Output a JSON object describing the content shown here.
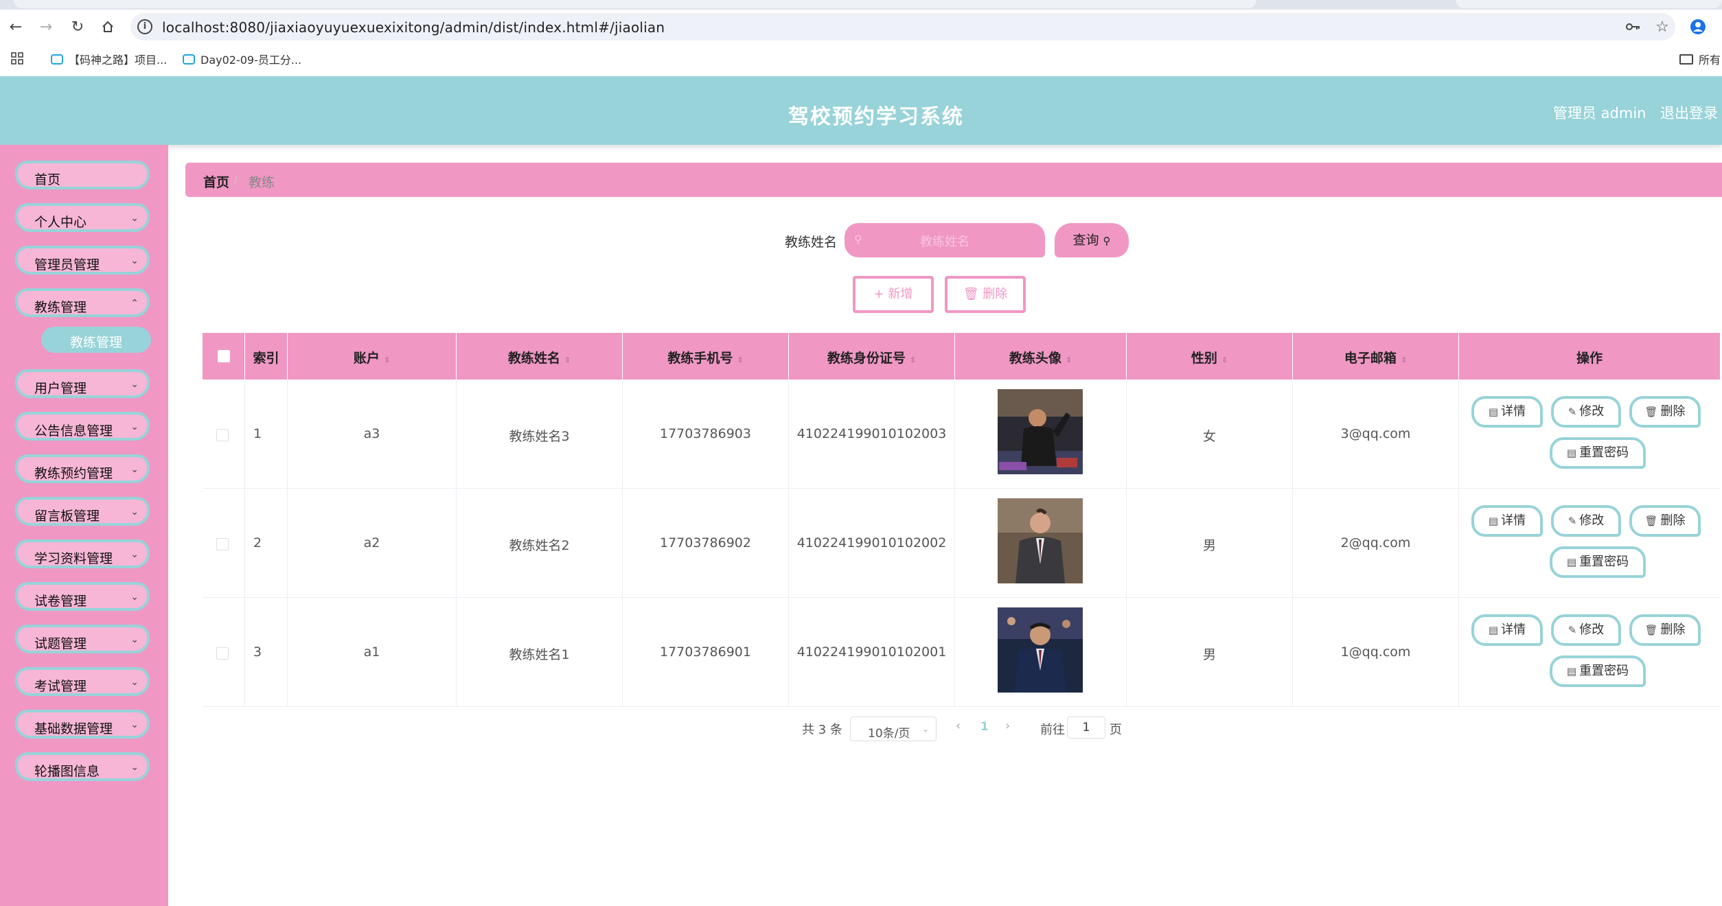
{
  "browser": {
    "url": "localhost:8080/jiaxiaoyuyuexuexixitong/admin/dist/index.html#/jiaolian",
    "bookmarks": [
      "【码神之路】项目...",
      "Day02-09-员工分..."
    ],
    "bookmarks_right": "所有"
  },
  "header": {
    "title": "驾校预约学习系统",
    "user": "管理员 admin",
    "logout": "退出登录"
  },
  "sidebar": {
    "items": [
      {
        "label": "首页",
        "expandable": false
      },
      {
        "label": "个人中心",
        "expandable": true
      },
      {
        "label": "管理员管理",
        "expandable": true
      },
      {
        "label": "教练管理",
        "expandable": true
      },
      {
        "label": "用户管理",
        "expandable": true
      },
      {
        "label": "公告信息管理",
        "expandable": true
      },
      {
        "label": "教练预约管理",
        "expandable": true
      },
      {
        "label": "留言板管理",
        "expandable": true
      },
      {
        "label": "学习资料管理",
        "expandable": true
      },
      {
        "label": "试卷管理",
        "expandable": true
      },
      {
        "label": "试题管理",
        "expandable": true
      },
      {
        "label": "考试管理",
        "expandable": true
      },
      {
        "label": "基础数据管理",
        "expandable": true
      },
      {
        "label": "轮播图信息",
        "expandable": true
      }
    ],
    "submenu_active": "教练管理"
  },
  "breadcrumb": {
    "home": "首页",
    "separator": "/",
    "current": "教练"
  },
  "search": {
    "label": "教练姓名",
    "placeholder": "教练姓名",
    "button": "查询"
  },
  "actions": {
    "add": "+ 新增",
    "delete": "删除"
  },
  "table": {
    "columns": [
      "索引",
      "账户",
      "教练姓名",
      "教练手机号",
      "教练身份证号",
      "教练头像",
      "性别",
      "电子邮箱",
      "操作"
    ],
    "rows": [
      {
        "index": "1",
        "account": "a3",
        "name": "教练姓名3",
        "phone": "17703786903",
        "idcard": "410224199010102003",
        "gender": "女",
        "email": "3@qq.com"
      },
      {
        "index": "2",
        "account": "a2",
        "name": "教练姓名2",
        "phone": "17703786902",
        "idcard": "410224199010102002",
        "gender": "男",
        "email": "2@qq.com"
      },
      {
        "index": "3",
        "account": "a1",
        "name": "教练姓名1",
        "phone": "17703786901",
        "idcard": "410224199010102001",
        "gender": "男",
        "email": "1@qq.com"
      }
    ],
    "ops": {
      "detail": "详情",
      "edit": "修改",
      "delete": "删除",
      "reset": "重置密码"
    }
  },
  "pagination": {
    "total": "共 3 条",
    "page_size": "10条/页",
    "current": "1",
    "goto": "前往",
    "goto_value": "1",
    "page_suffix": "页"
  },
  "colors": {
    "pink": "#f097c4",
    "teal": "#97d3d9"
  }
}
